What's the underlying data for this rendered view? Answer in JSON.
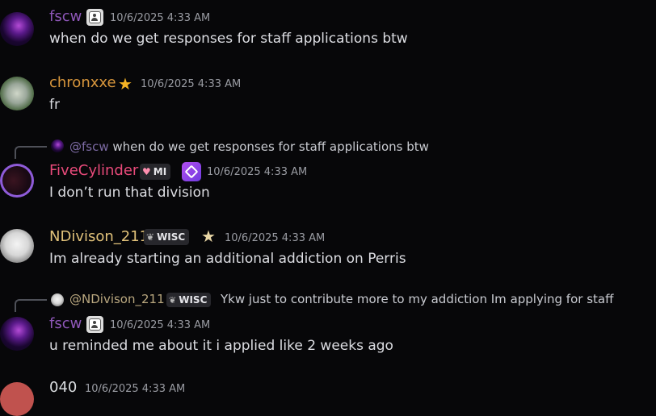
{
  "messages": [
    {
      "author": "fscw",
      "author_color": "#8e57b8",
      "timestamp": "10/6/2025 4:33 AM",
      "text": "when do we get responses for staff applications btw"
    },
    {
      "author": "chronxxe",
      "author_color": "#d8963c",
      "badge_icon": "star-icon",
      "timestamp": "10/6/2025 4:33 AM",
      "text": "fr"
    },
    {
      "reply": {
        "author": "@fscw",
        "text": "when do we get responses for staff applications btw"
      },
      "author": "FiveCylinder",
      "author_color": "#e84a7a",
      "tag": "MI",
      "tag_icon": "heart-icon",
      "timestamp": "10/6/2025 4:33 AM",
      "text": "I don’t run that division"
    },
    {
      "author": "NDivison_211",
      "author_color": "#e1c27a",
      "tag": "WISC",
      "tag_icon": "leaf-icon",
      "badge_icon": "star-icon",
      "timestamp": "10/6/2025 4:33 AM",
      "text": "Im already starting an additional addiction on Perris"
    },
    {
      "reply": {
        "author": "@NDivison_211",
        "tag": "WISC",
        "text": "Ykw just to contribute more to my addiction Im applying for staff"
      },
      "author": "fscw",
      "author_color": "#8e57b8",
      "timestamp": "10/6/2025 4:33 AM",
      "text": "u reminded me about it i applied like 2 weeks ago"
    },
    {
      "author": "040",
      "author_color": "#dbdee1",
      "timestamp": "10/6/2025 4:33 AM"
    }
  ]
}
